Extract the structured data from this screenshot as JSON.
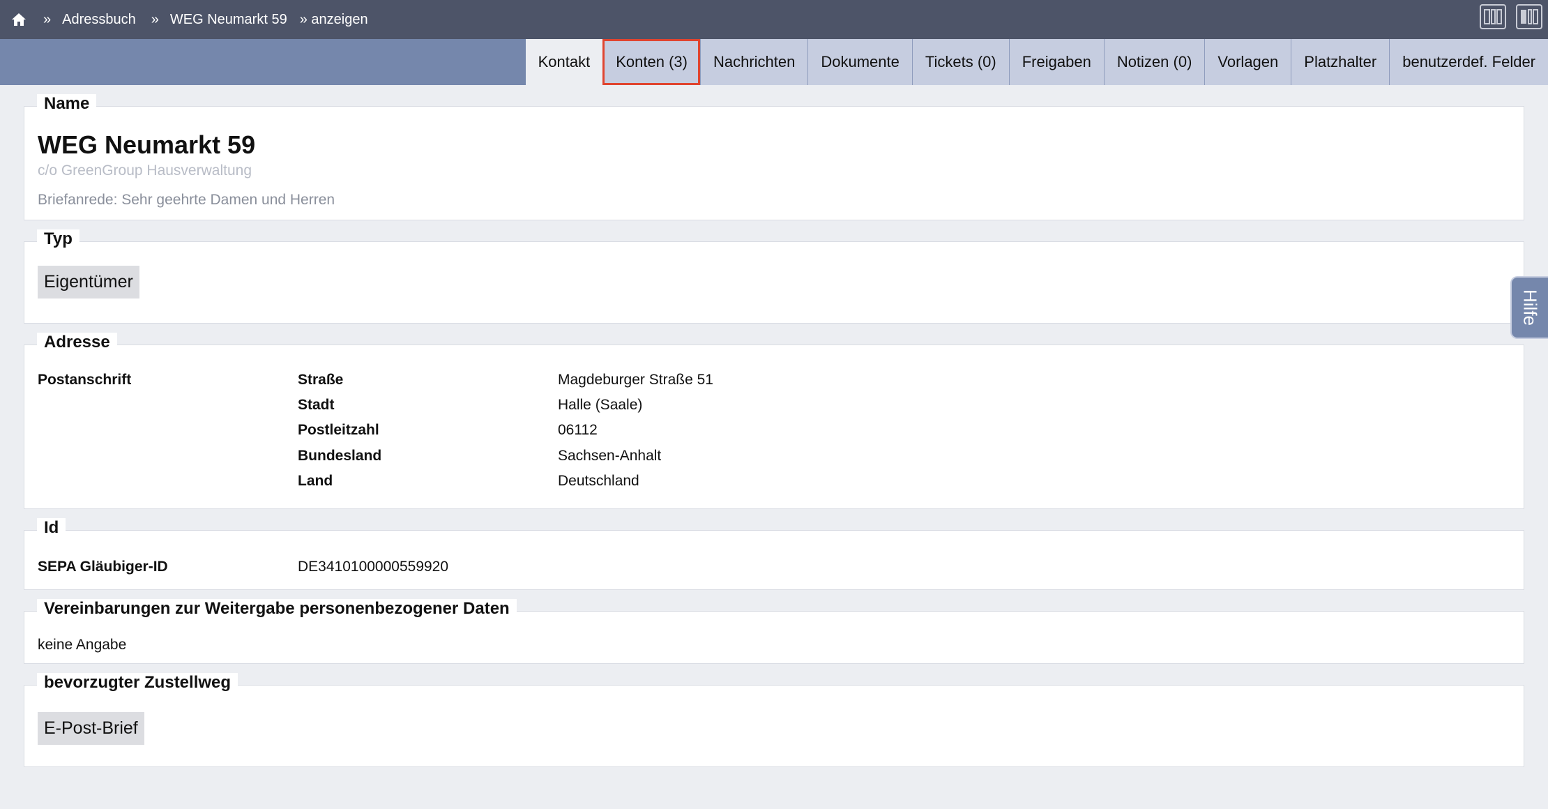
{
  "breadcrumb": {
    "home_icon": "home-icon",
    "separator": "»",
    "items": [
      "Adressbuch",
      "WEG Neumarkt 59"
    ],
    "current": "» anzeigen"
  },
  "layout_toggles": [
    "layout-two-columns-icon",
    "layout-single-column-icon"
  ],
  "tabs": [
    {
      "label": "Kontakt",
      "active": true
    },
    {
      "label": "Konten (3)",
      "highlighted": true
    },
    {
      "label": "Nachrichten"
    },
    {
      "label": "Dokumente"
    },
    {
      "label": "Tickets (0)"
    },
    {
      "label": "Freigaben"
    },
    {
      "label": "Notizen (0)"
    },
    {
      "label": "Vorlagen"
    },
    {
      "label": "Platzhalter"
    },
    {
      "label": "benutzerdef. Felder"
    }
  ],
  "sections": {
    "name": {
      "legend": "Name",
      "title": "WEG Neumarkt 59",
      "co": "c/o GreenGroup Hausverwaltung",
      "salutation": "Briefanrede: Sehr geehrte Damen und Herren"
    },
    "typ": {
      "legend": "Typ",
      "tag": "Eigentümer"
    },
    "adresse": {
      "legend": "Adresse",
      "group_label": "Postanschrift",
      "rows": [
        {
          "label": "Straße",
          "value": "Magdeburger Straße 51"
        },
        {
          "label": "Stadt",
          "value": "Halle (Saale)"
        },
        {
          "label": "Postleitzahl",
          "value": "06112"
        },
        {
          "label": "Bundesland",
          "value": "Sachsen-Anhalt"
        },
        {
          "label": "Land",
          "value": "Deutschland"
        }
      ]
    },
    "id": {
      "legend": "Id",
      "label": "SEPA Gläubiger-ID",
      "value": "DE3410100000559920"
    },
    "vereinbarungen": {
      "legend": "Vereinbarungen zur Weitergabe personenbezogener Daten",
      "value": "keine Angabe"
    },
    "zustellweg": {
      "legend": "bevorzugter Zustellweg",
      "tag": "E-Post-Brief"
    }
  },
  "help": {
    "label": "Hilfe"
  },
  "colors": {
    "topbar": "#4d5468",
    "tabbar": "#7587ac",
    "tab": "#c6cde0",
    "highlight": "#e0442f",
    "background": "#eceef2"
  }
}
